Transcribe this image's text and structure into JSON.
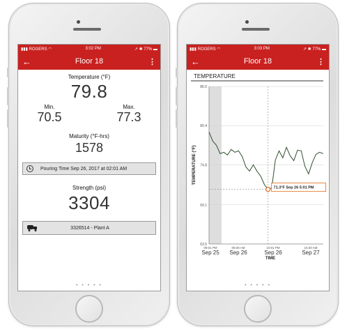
{
  "left": {
    "status": {
      "carrier": "ROGERS",
      "time": "3:02 PM",
      "battery": "77%"
    },
    "title": "Floor 18",
    "temperature_label": "Temperature (°F)",
    "temperature_value": "79.8",
    "min_label": "Min.",
    "min_value": "70.5",
    "max_label": "Max.",
    "max_value": "77.3",
    "maturity_label": "Maturity (°F-hrs)",
    "maturity_value": "1578",
    "pouring_text": "Pouring Time Sep 26, 2017 at 02:01 AM",
    "strength_label": "Strength (psi)",
    "strength_value": "3304",
    "plant_text": "3326514 - Plant A",
    "page_dots": "• • • • •"
  },
  "right": {
    "status": {
      "carrier": "ROGERS",
      "time": "3:03 PM",
      "battery": "77%"
    },
    "title": "Floor 18",
    "chart_title": "TEMPERATURE",
    "tooltip": "71.3°F Sep 26 5:01 PM",
    "page_dots": "• • • • •"
  },
  "chart_data": {
    "type": "line",
    "title": "TEMPERATURE",
    "xlabel": "TIME",
    "ylabel": "TEMPERATURE (°F)",
    "ylim": [
      63.5,
      86.0
    ],
    "yticks": [
      "86.0",
      "80.4",
      "74.8",
      "69.1",
      "63.5"
    ],
    "xticks": [
      {
        "time": "09:01 PM",
        "date": "Sep 25"
      },
      {
        "time": "09:30 AM",
        "date": "Sep 26"
      },
      {
        "time": "10:01 PM",
        "date": "Sep 26"
      },
      {
        "time": "10:30 AM",
        "date": "Sep 27"
      }
    ],
    "series": [
      {
        "values": [
          79.5,
          78.2,
          77.6,
          76.4,
          76.6,
          76.2,
          77.0,
          76.6,
          76.8,
          76.0,
          74.5,
          73.9,
          74.8,
          73.9,
          73.2,
          72.0,
          71.3,
          71.5,
          75.5,
          76.8,
          75.8,
          77.3,
          76.1,
          75.4,
          76.9,
          76.8,
          74.6,
          73.5,
          75.1,
          76.3,
          76.6,
          76.4
        ]
      }
    ],
    "highlight": {
      "value": 71.3,
      "label": "71.3°F Sep 26 5:01 PM"
    }
  }
}
